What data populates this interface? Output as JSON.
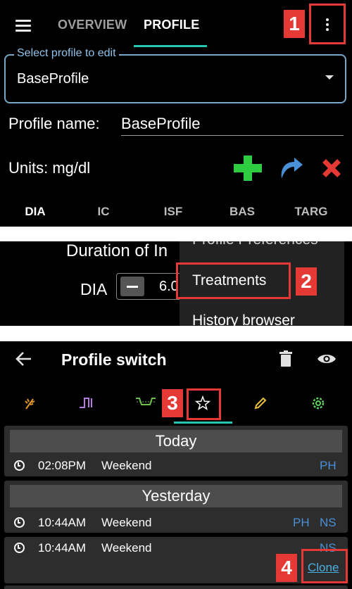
{
  "panel1": {
    "tabs": [
      "OVERVIEW",
      "PROFILE"
    ],
    "active_tab": "PROFILE",
    "select_label": "Select profile to edit",
    "select_value": "BaseProfile",
    "profile_name_label": "Profile name:",
    "profile_name_value": "BaseProfile",
    "units_label": "Units: mg/dl",
    "subtabs": [
      "DIA",
      "IC",
      "ISF",
      "BAS",
      "TARG"
    ],
    "active_subtab": "DIA",
    "marker": "1"
  },
  "panel2": {
    "duration_title": "Duration of In",
    "dia_label": "DIA",
    "dia_value": "6.0",
    "menu_items": [
      "Profile Preferences",
      "Treatments",
      "History browser"
    ],
    "marker": "2"
  },
  "panel3": {
    "title": "Profile switch",
    "marker": "3",
    "tab_icons": [
      "wheat-icon",
      "basal-icon",
      "temp-target-icon",
      "star-icon",
      "pencil-icon",
      "gear-icon"
    ],
    "tab_colors": [
      "#e0962a",
      "#b47be0",
      "#6cc04a",
      "#ffffff",
      "#e8c040",
      "#5ed35e"
    ],
    "groups": [
      {
        "header": "Today",
        "rows": [
          {
            "time": "02:08PM",
            "name": "Weekend",
            "tags": [
              "PH"
            ]
          }
        ]
      },
      {
        "header": "Yesterday",
        "rows": [
          {
            "time": "10:44AM",
            "name": "Weekend",
            "tags": [
              "PH",
              "NS"
            ]
          },
          {
            "time": "10:44AM",
            "name": "Weekend",
            "tags": [
              "NS"
            ],
            "action": "Clone"
          }
        ]
      }
    ],
    "clone_marker": "4"
  },
  "colors": {
    "accent_underline": "#26c6b2",
    "marker_red": "#e53935",
    "add_green": "#2ecc40",
    "redo_blue": "#4a90d9",
    "delete_red": "#e53935",
    "tag_blue": "#4a90d9"
  }
}
